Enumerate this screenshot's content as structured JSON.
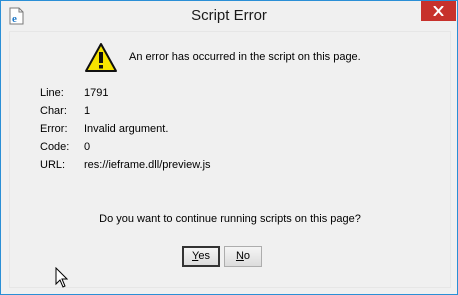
{
  "window": {
    "title": "Script Error",
    "accent": "#2a8fd6"
  },
  "icons": {
    "app": "ie-page-icon",
    "close": "close-icon",
    "warning": "warning-icon"
  },
  "message": "An error has occurred in the script on this page.",
  "details": [
    {
      "label": "Line:",
      "value": "1791"
    },
    {
      "label": "Char:",
      "value": "1"
    },
    {
      "label": "Error:",
      "value": "Invalid argument."
    },
    {
      "label": "Code:",
      "value": "0"
    },
    {
      "label": "URL:",
      "value": "res://ieframe.dll/preview.js"
    }
  ],
  "question": "Do you want to continue running scripts on this page?",
  "buttons": {
    "yes": {
      "mnemonic": "Y",
      "rest": "es"
    },
    "no": {
      "mnemonic": "N",
      "rest": "o"
    }
  }
}
